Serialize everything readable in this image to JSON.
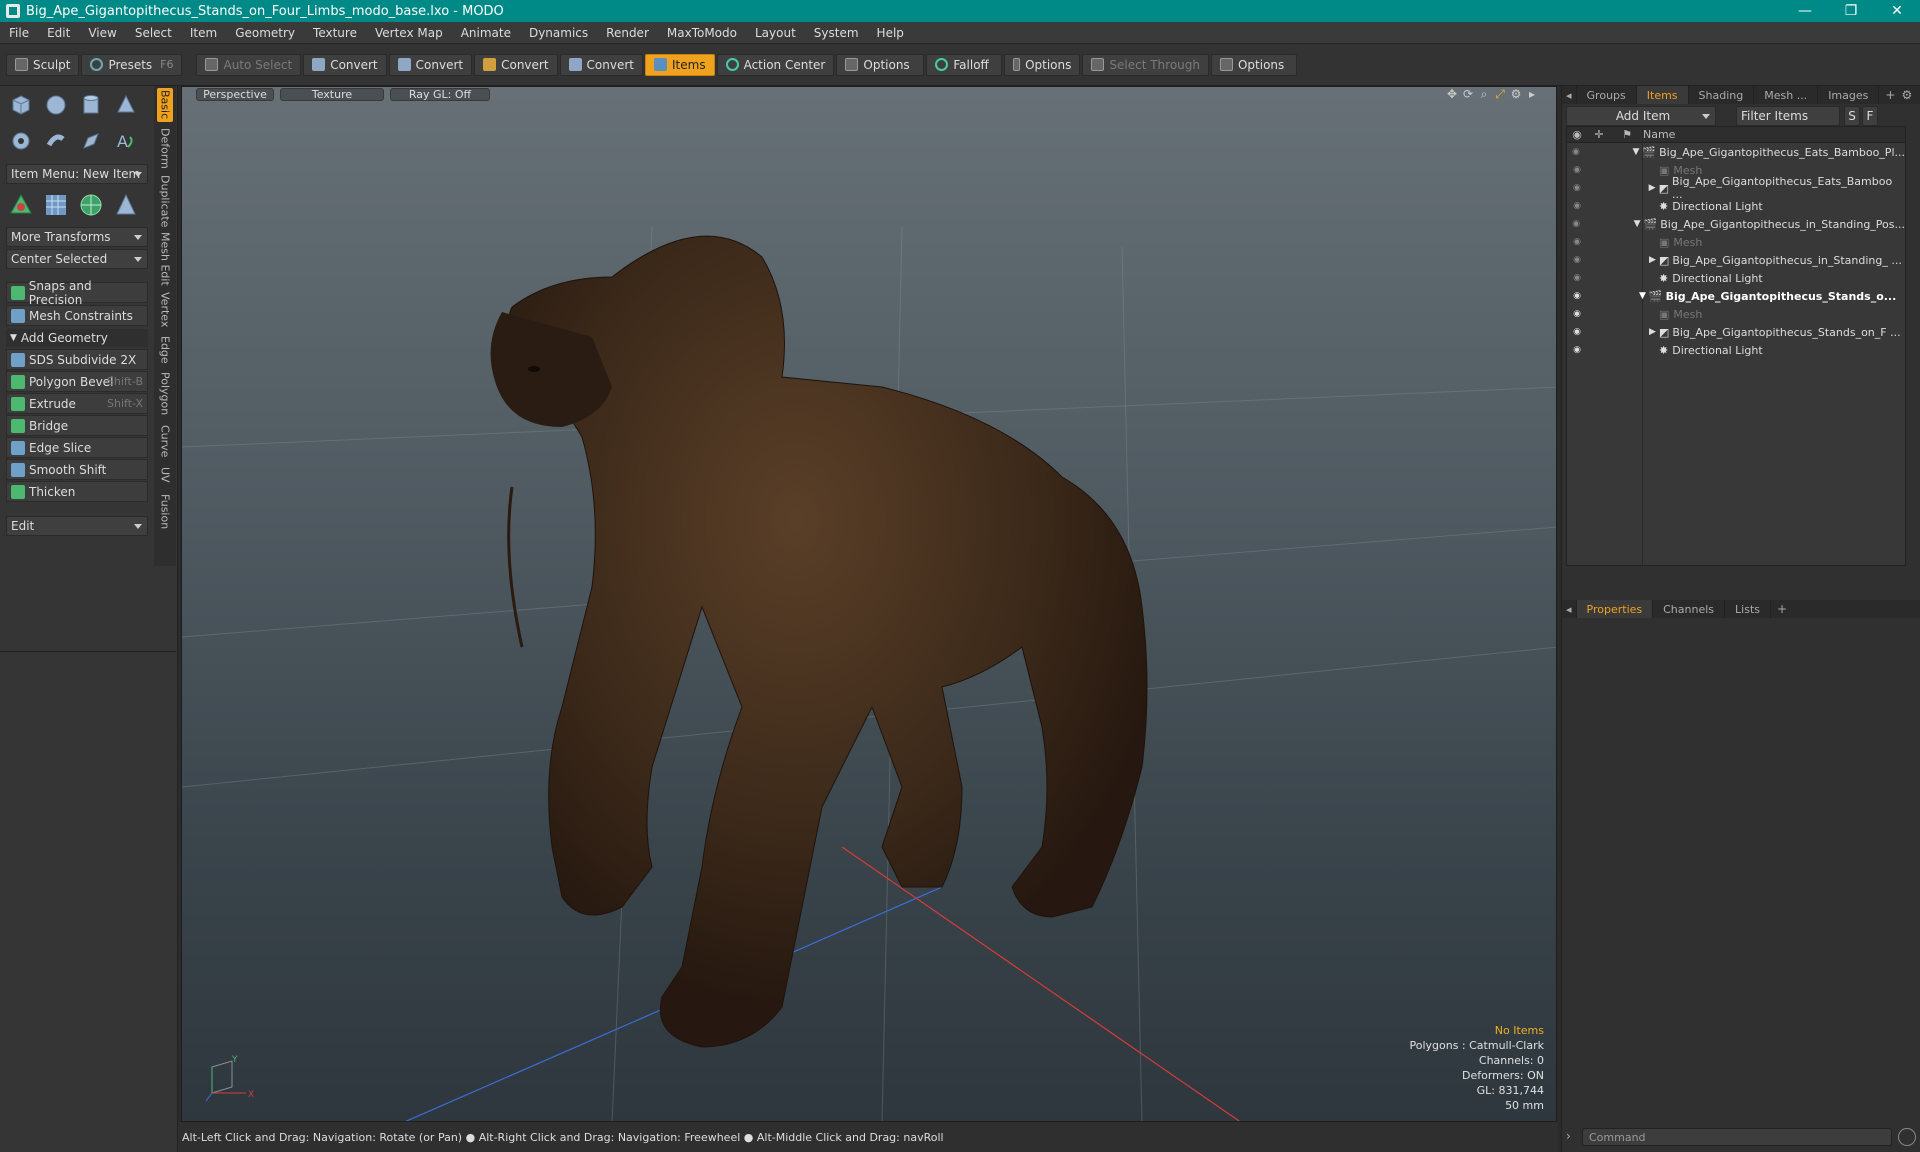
{
  "window": {
    "title": "Big_Ape_Gigantopithecus_Stands_on_Four_Limbs_modo_base.lxo - MODO",
    "minimize": "—",
    "maximize": "❐",
    "close": "✕"
  },
  "menu": [
    "File",
    "Edit",
    "View",
    "Select",
    "Item",
    "Geometry",
    "Texture",
    "Vertex Map",
    "Animate",
    "Dynamics",
    "Render",
    "MaxToModo",
    "Layout",
    "System",
    "Help"
  ],
  "toolbar": {
    "sculpt": "Sculpt",
    "presets": "Presets",
    "presets_key": "F6",
    "auto_select": "Auto Select",
    "convert": "Convert",
    "items": "Items",
    "action_center": "Action Center",
    "options": "Options",
    "falloff": "Falloff",
    "select_through": "Select Through"
  },
  "left": {
    "item_menu": "Item Menu: New Item",
    "more_transforms": "More Transforms",
    "center_selected": "Center Selected",
    "snaps": "Snaps and Precision",
    "mesh_constraints": "Mesh Constraints",
    "add_geometry": "Add Geometry",
    "tools": [
      {
        "label": "SDS Subdivide 2X",
        "shortcut": ""
      },
      {
        "label": "Polygon Bevel",
        "shortcut": "Shift-B"
      },
      {
        "label": "Extrude",
        "shortcut": "Shift-X"
      },
      {
        "label": "Bridge",
        "shortcut": ""
      },
      {
        "label": "Edge Slice",
        "shortcut": ""
      },
      {
        "label": "Smooth Shift",
        "shortcut": ""
      },
      {
        "label": "Thicken",
        "shortcut": ""
      }
    ],
    "edit": "Edit",
    "side_tabs": [
      "Basic",
      "Deform",
      "Duplicate",
      "Mesh Edit",
      "Vertex",
      "Edge",
      "Polygon",
      "Curve",
      "UV",
      "Fusion"
    ]
  },
  "viewport": {
    "view": "Perspective",
    "shading": "Texture",
    "raygl": "Ray GL: Off",
    "info": {
      "no_items": "No Items",
      "polygons": "Polygons : Catmull-Clark",
      "channels": "Channels: 0",
      "deformers": "Deformers: ON",
      "gl": "GL: 831,744",
      "lens": "50 mm"
    },
    "axis_y": "Y",
    "axis_x": "X"
  },
  "status": "Alt-Left Click and Drag: Navigation: Rotate (or Pan) ● Alt-Right Click and Drag: Navigation: Freewheel ● Alt-Middle Click and Drag: navRoll",
  "right": {
    "tabs": [
      "Groups",
      "Items",
      "Shading",
      "Mesh ...",
      "Images"
    ],
    "add_item": "Add Item",
    "filter_items": "Filter Items",
    "s_btn": "S",
    "f_btn": "F",
    "name_col": "Name",
    "tree": [
      {
        "label": "Big_Ape_Gigantopithecus_Eats_Bamboo_Pl...",
        "level": 0,
        "bold": false
      },
      {
        "label": "Mesh",
        "level": 1,
        "bold": false,
        "dim": true
      },
      {
        "label": "Big_Ape_Gigantopithecus_Eats_Bamboo ...",
        "level": 1,
        "bold": false
      },
      {
        "label": "Directional Light",
        "level": 1,
        "bold": false
      },
      {
        "label": "Big_Ape_Gigantopithecus_in_Standing_Pos...",
        "level": 0,
        "bold": false
      },
      {
        "label": "Mesh",
        "level": 1,
        "bold": false,
        "dim": true
      },
      {
        "label": "Big_Ape_Gigantopithecus_in_Standing_ ...",
        "level": 1,
        "bold": false
      },
      {
        "label": "Directional Light",
        "level": 1,
        "bold": false
      },
      {
        "label": "Big_Ape_Gigantopithecus_Stands_o...",
        "level": 0,
        "bold": true
      },
      {
        "label": "Mesh",
        "level": 1,
        "bold": false,
        "dim": true
      },
      {
        "label": "Big_Ape_Gigantopithecus_Stands_on_F ...",
        "level": 1,
        "bold": false
      },
      {
        "label": "Directional Light",
        "level": 1,
        "bold": false
      }
    ],
    "prop_tabs": [
      "Properties",
      "Channels",
      "Lists"
    ],
    "command": "Command"
  }
}
